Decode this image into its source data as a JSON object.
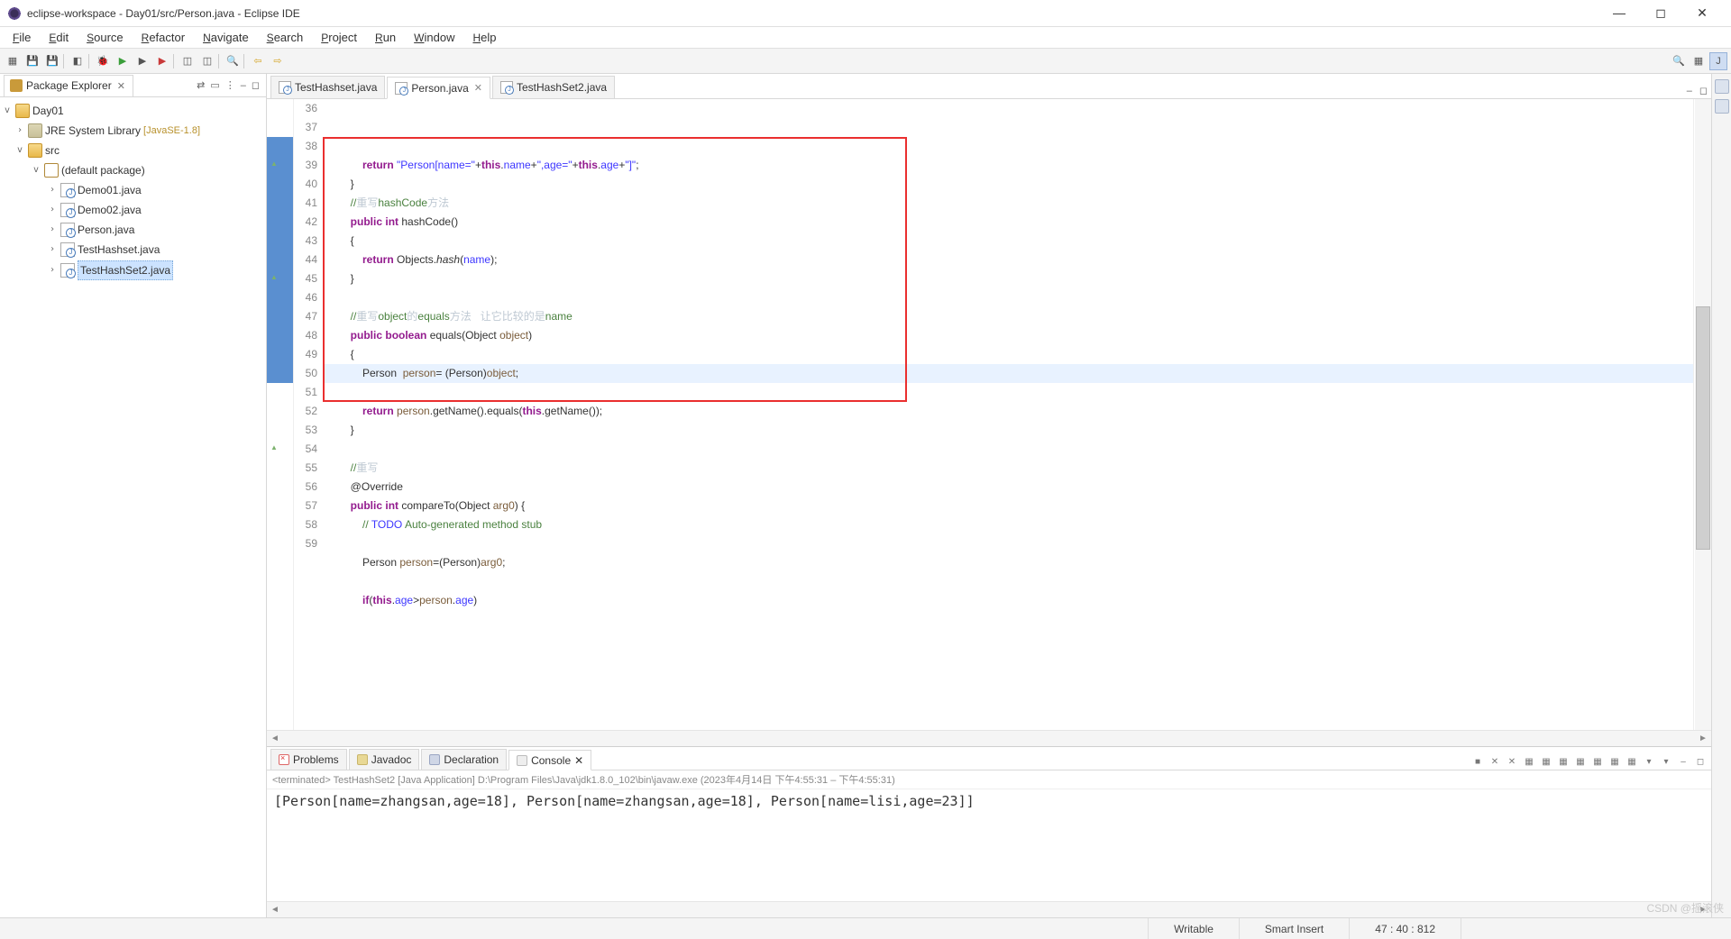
{
  "window": {
    "title": "eclipse-workspace - Day01/src/Person.java - Eclipse IDE"
  },
  "menu": [
    "File",
    "Edit",
    "Source",
    "Refactor",
    "Navigate",
    "Search",
    "Project",
    "Run",
    "Window",
    "Help"
  ],
  "package_explorer": {
    "title": "Package Explorer",
    "project": "Day01",
    "jre": "JRE System Library",
    "jre_ver": "[JavaSE-1.8]",
    "src": "src",
    "pkg": "(default package)",
    "files": [
      "Demo01.java",
      "Demo02.java",
      "Person.java",
      "TestHashset.java",
      "TestHashSet2.java"
    ],
    "selected": "TestHashSet2.java"
  },
  "editor_tabs": [
    {
      "label": "TestHashset.java",
      "active": false,
      "closable": false
    },
    {
      "label": "Person.java",
      "active": true,
      "closable": true
    },
    {
      "label": "TestHashSet2.java",
      "active": false,
      "closable": false
    }
  ],
  "code_start": 36,
  "code": [
    {
      "n": 36,
      "html": "            <span class='kw'>return</span> <span class='str'>\"Person[name=\"</span>+<span class='kw'>this</span>.<span class='field'>name</span>+<span class='str'>\",age=\"</span>+<span class='kw'>this</span>.<span class='field'>age</span>+<span class='str'>\"]\"</span>;"
    },
    {
      "n": 37,
      "html": "        }"
    },
    {
      "n": 38,
      "html": "        <span class='cm'>//</span><span class='cmz'>重写</span><span class='cm'>hashCode</span><span class='cmz'>方法</span>",
      "gut": "blue"
    },
    {
      "n": 39,
      "html": "        <span class='kw'>public</span> <span class='kw'>int</span> hashCode()",
      "gut": "ov blue"
    },
    {
      "n": 40,
      "html": "        {",
      "gut": "blue"
    },
    {
      "n": 41,
      "html": "            <span class='kw'>return</span> Objects.<span class='fn'>hash</span>(<span class='field'>name</span>);",
      "gut": "blue"
    },
    {
      "n": 42,
      "html": "        }",
      "gut": "blue"
    },
    {
      "n": 43,
      "html": "",
      "gut": "blue"
    },
    {
      "n": 44,
      "html": "        <span class='cm'>//</span><span class='cmz'>重写</span><span class='cm'>object</span><span class='cmz'>的</span><span class='cm'>equals</span><span class='cmz'>方法   让它比较的是</span><span class='cm'>name</span>",
      "gut": "blue"
    },
    {
      "n": 45,
      "html": "        <span class='kw'>public</span> <span class='kw'>boolean</span> equals(Object <span class='var'>object</span>)",
      "gut": "ov blue"
    },
    {
      "n": 46,
      "html": "        {",
      "gut": "blue"
    },
    {
      "n": 47,
      "html": "            Person  <span class='var'>person</span>= (Person)<span class='var'>object</span>;",
      "gut": "blue",
      "cur": true
    },
    {
      "n": 48,
      "html": "",
      "gut": "blue"
    },
    {
      "n": 49,
      "html": "            <span class='kw'>return</span> <span class='var'>person</span>.getName().equals(<span class='kw'>this</span>.getName());",
      "gut": "blue"
    },
    {
      "n": 50,
      "html": "        }",
      "gut": "blue"
    },
    {
      "n": 51,
      "html": ""
    },
    {
      "n": 52,
      "html": "        <span class='cm'>//</span><span class='cmz'>重写</span>"
    },
    {
      "n": 53,
      "html": "        <span class='tp'>@Override</span>"
    },
    {
      "n": 54,
      "html": "        <span class='kw'>public</span> <span class='kw'>int</span> compareTo(Object <span class='var'>arg0</span>) {",
      "gut": "ov"
    },
    {
      "n": 55,
      "html": "            <span class='cm'>// </span><span class='field'>TODO</span><span class='cm'> Auto-generated method stub</span>"
    },
    {
      "n": 56,
      "html": ""
    },
    {
      "n": 57,
      "html": "            Person <span class='var'>person</span>=(Person)<span class='var'>arg0</span>;"
    },
    {
      "n": 58,
      "html": ""
    },
    {
      "n": 59,
      "html": "            <span class='kw'>if</span>(<span class='kw'>this</span>.<span class='field'>age</span>&gt;<span class='var'>person</span>.<span class='field'>age</span>)"
    }
  ],
  "bottom_tabs": [
    {
      "label": "Problems",
      "ic": "bic-prob"
    },
    {
      "label": "Javadoc",
      "ic": "bic-doc"
    },
    {
      "label": "Declaration",
      "ic": "bic-decl"
    },
    {
      "label": "Console",
      "ic": "bic-con",
      "active": true,
      "closable": true
    }
  ],
  "console": {
    "head": "<terminated> TestHashSet2 [Java Application] D:\\Program Files\\Java\\jdk1.8.0_102\\bin\\javaw.exe  (2023年4月14日 下午4:55:31 – 下午4:55:31)",
    "out": "[Person[name=zhangsan,age=18], Person[name=zhangsan,age=18], Person[name=lisi,age=23]]"
  },
  "status": {
    "write": "Writable",
    "insert": "Smart Insert",
    "pos": "47 : 40 : 812"
  },
  "watermark": "CSDN @摇滚侠"
}
